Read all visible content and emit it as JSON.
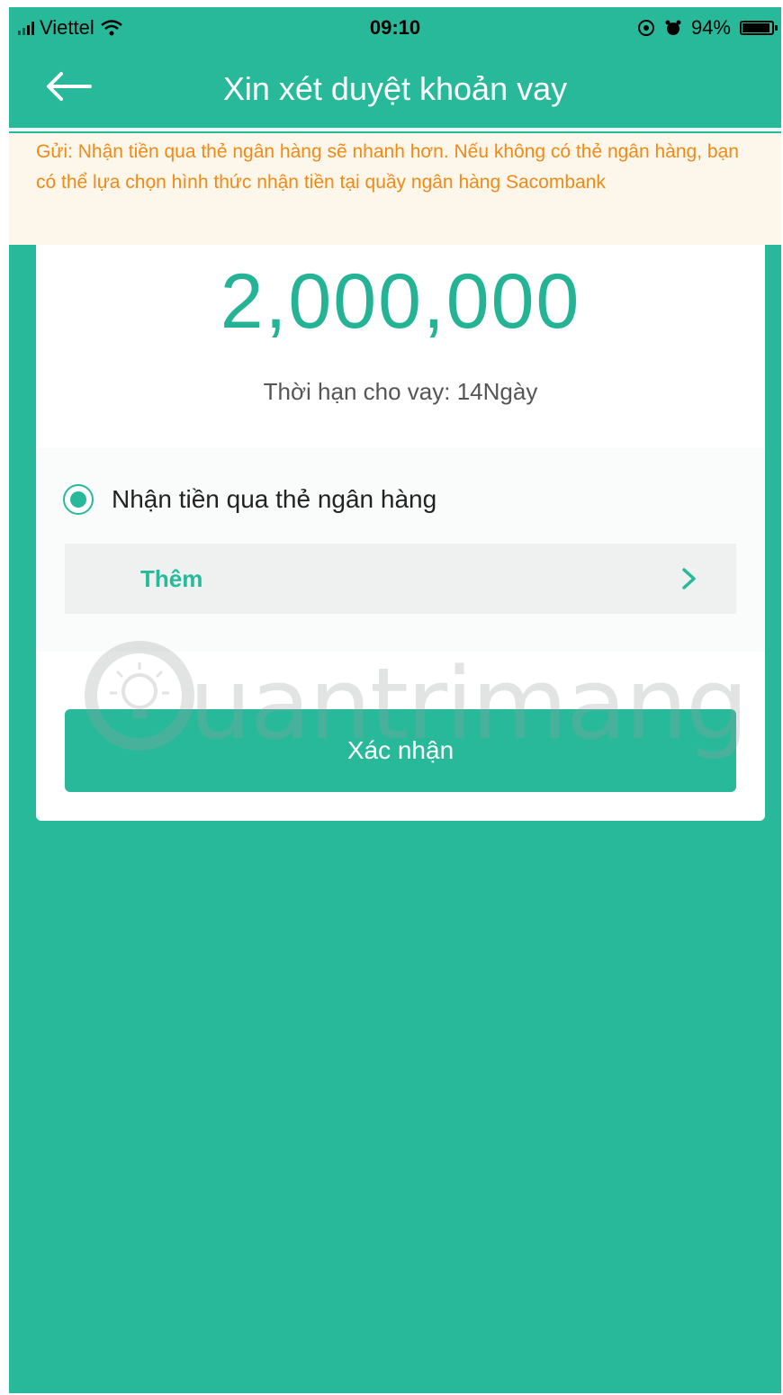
{
  "status_bar": {
    "carrier": "Viettel",
    "time": "09:10",
    "battery": "94%",
    "battery_level": 0.94
  },
  "nav": {
    "title": "Xin xét duyệt khoản vay"
  },
  "notice": {
    "text": "Gửi: Nhận tiền qua thẻ ngân hàng sẽ nhanh hơn. Nếu không có thẻ ngân hàng, bạn có thể lựa chọn hình thức nhận tiền tại quầy ngân hàng Sacombank"
  },
  "loan": {
    "amount": "2,000,000",
    "term": "Thời hạn cho vay: 14Ngày"
  },
  "receive_method": {
    "option_label": "Nhận tiền qua thẻ ngân hàng",
    "selected": true,
    "add_label": "Thêm"
  },
  "actions": {
    "confirm_label": "Xác nhận"
  },
  "colors": {
    "brand": "#27b99a",
    "notice_text": "#f08a16",
    "notice_bg": "#fdf6ea"
  }
}
